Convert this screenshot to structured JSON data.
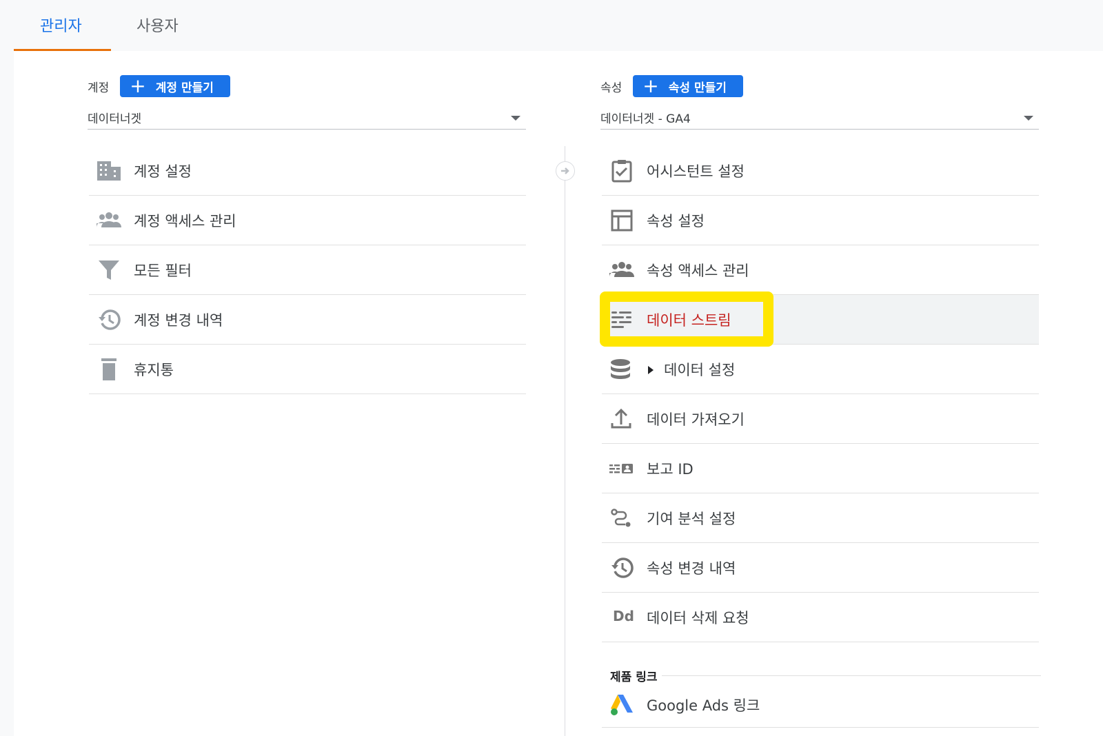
{
  "tabs": [
    {
      "label": "관리자",
      "active": true
    },
    {
      "label": "사용자",
      "active": false
    }
  ],
  "account": {
    "label": "계정",
    "create_label": "계정 만들기",
    "selected": "데이터너겟",
    "items": [
      {
        "label": "계정 설정",
        "icon": "building-icon"
      },
      {
        "label": "계정 액세스 관리",
        "icon": "people-icon"
      },
      {
        "label": "모든 필터",
        "icon": "filter-icon"
      },
      {
        "label": "계정 변경 내역",
        "icon": "history-icon"
      },
      {
        "label": "휴지통",
        "icon": "trash-icon"
      }
    ]
  },
  "property": {
    "label": "속성",
    "create_label": "속성 만들기",
    "selected": "데이터너겟 - GA4",
    "items": [
      {
        "label": "어시스턴트 설정",
        "icon": "checklist-icon"
      },
      {
        "label": "속성 설정",
        "icon": "layout-icon"
      },
      {
        "label": "속성 액세스 관리",
        "icon": "people-icon"
      },
      {
        "label": "데이터 스트림",
        "icon": "streams-icon",
        "selected": true
      },
      {
        "label": "데이터 설정",
        "icon": "database-icon",
        "expandable": true
      },
      {
        "label": "데이터 가져오기",
        "icon": "upload-icon"
      },
      {
        "label": "보고 ID",
        "icon": "reporting-id-icon"
      },
      {
        "label": "기여 분석 설정",
        "icon": "attribution-icon"
      },
      {
        "label": "속성 변경 내역",
        "icon": "history-icon"
      },
      {
        "label": "데이터 삭제 요청",
        "icon": "data-deletion-icon",
        "icon_text": "Dd"
      }
    ],
    "product_links_title": "제품 링크",
    "product_links": [
      {
        "label": "Google Ads 링크",
        "icon": "google-ads-icon"
      }
    ]
  },
  "colors": {
    "accent_blue": "#1a73e8",
    "tab_underline": "#e8710a",
    "selected_text": "#c5221f",
    "highlight": "#ffe600"
  }
}
